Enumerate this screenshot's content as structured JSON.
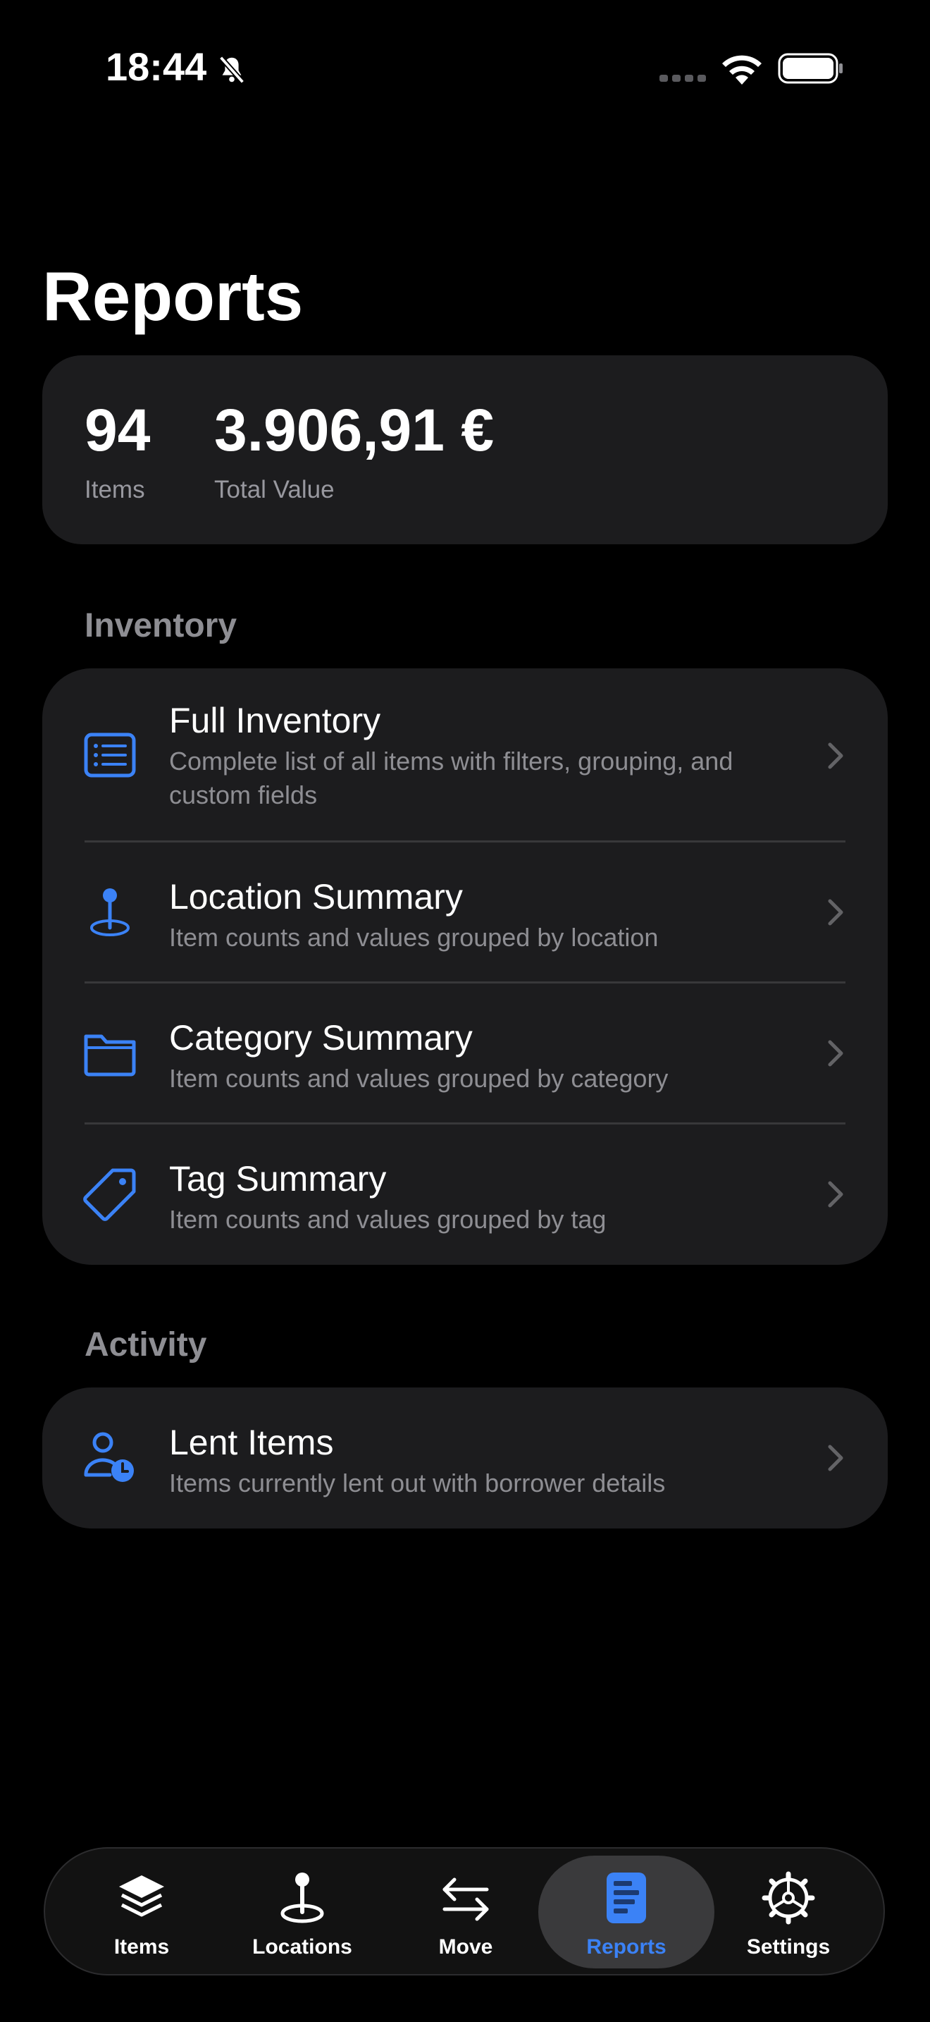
{
  "status_bar": {
    "time": "18:44"
  },
  "title": "Reports",
  "summary": {
    "items_value": "94",
    "items_label": "Items",
    "total_value": "3.906,91 €",
    "total_label": "Total Value"
  },
  "sections": {
    "inventory": {
      "header": "Inventory",
      "rows": [
        {
          "title": "Full Inventory",
          "subtitle": "Complete list of all items with filters, grouping, and custom fields",
          "icon": "list-icon"
        },
        {
          "title": "Location Summary",
          "subtitle": "Item counts and values grouped by location",
          "icon": "location-pin-icon"
        },
        {
          "title": "Category Summary",
          "subtitle": "Item counts and values grouped by category",
          "icon": "folder-icon"
        },
        {
          "title": "Tag Summary",
          "subtitle": "Item counts and values grouped by tag",
          "icon": "tag-icon"
        }
      ]
    },
    "activity": {
      "header": "Activity",
      "rows": [
        {
          "title": "Lent Items",
          "subtitle": "Items currently lent out with borrower details",
          "icon": "person-clock-icon"
        }
      ]
    }
  },
  "tab_bar": {
    "tabs": [
      {
        "label": "Items",
        "icon": "stack-icon",
        "active": false
      },
      {
        "label": "Locations",
        "icon": "location-pin-icon",
        "active": false
      },
      {
        "label": "Move",
        "icon": "arrows-swap-icon",
        "active": false
      },
      {
        "label": "Reports",
        "icon": "report-icon",
        "active": true
      },
      {
        "label": "Settings",
        "icon": "gear-icon",
        "active": false
      }
    ]
  },
  "colors": {
    "accent": "#3b82f6",
    "background": "#000000",
    "card": "#1c1c1e",
    "secondary_text": "#8e8e93"
  }
}
